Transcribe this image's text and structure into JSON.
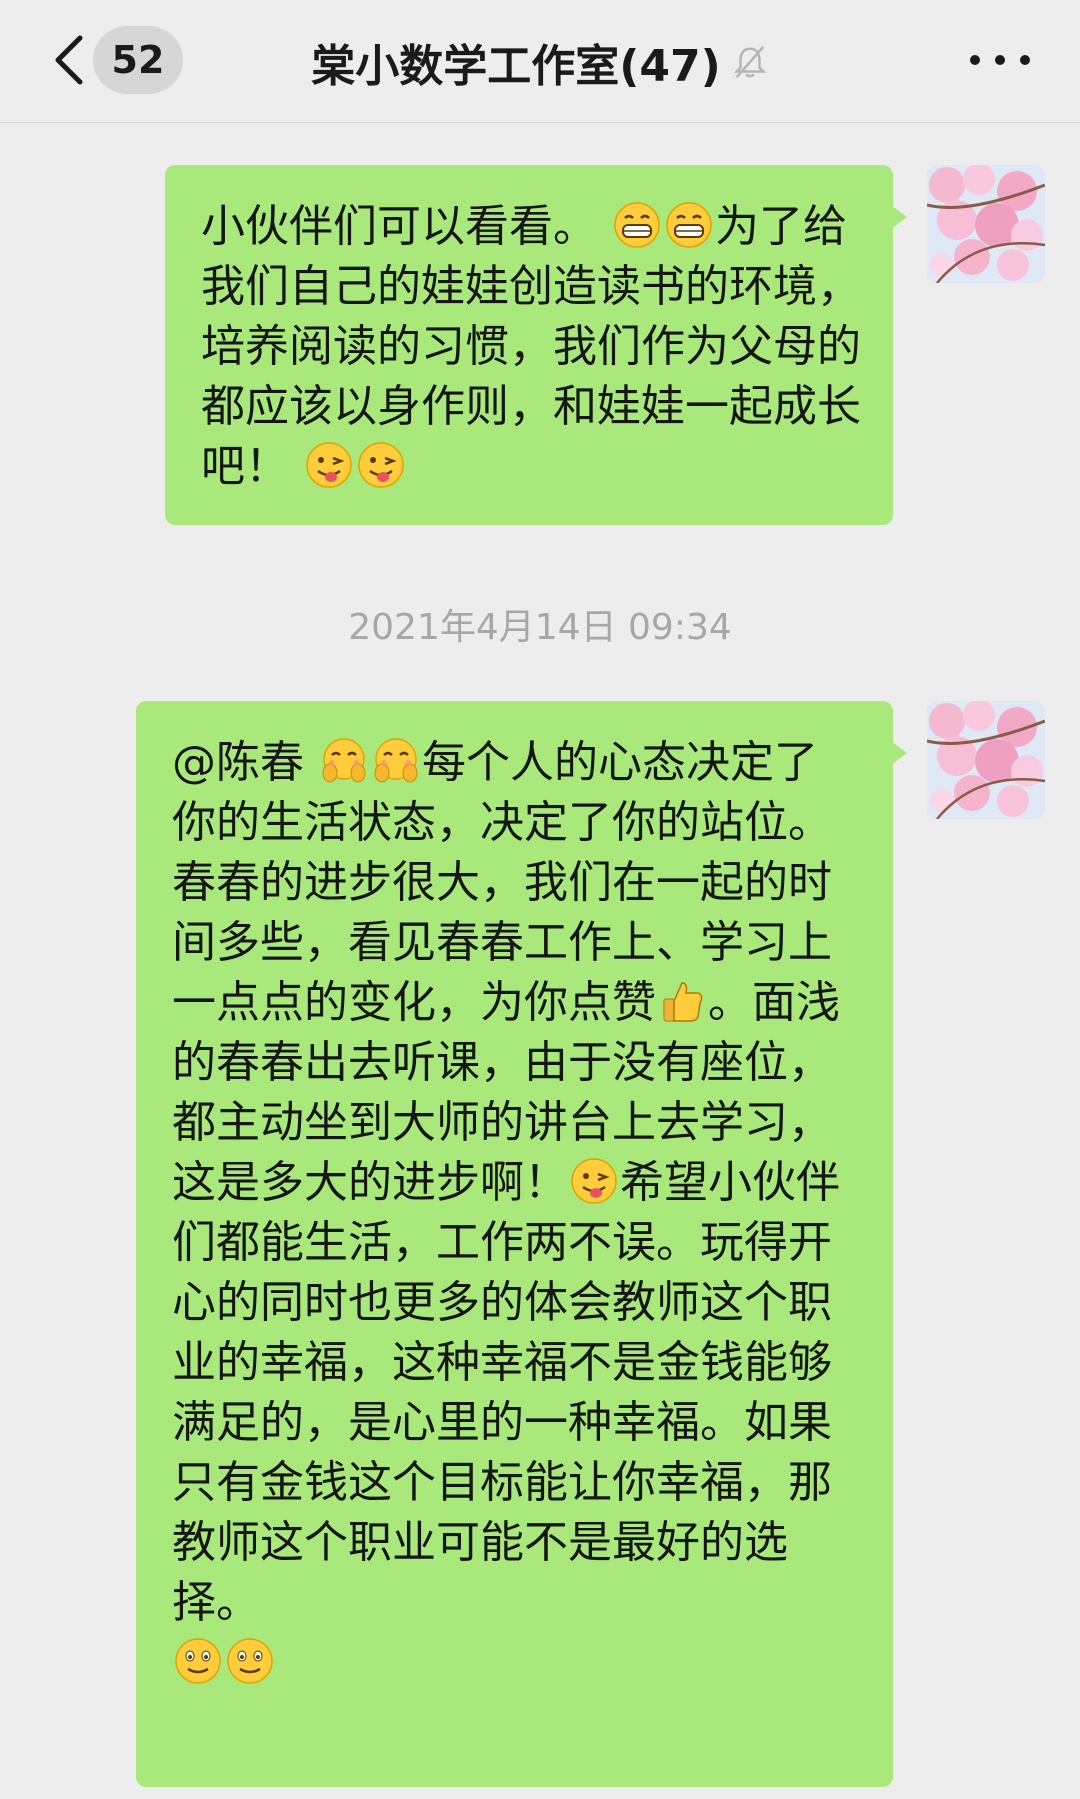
{
  "nav": {
    "unread_count": "52",
    "title": "棠小数学工作室(47)"
  },
  "messages": [
    {
      "text_parts": [
        "小伙伴们可以看看。",
        "为了给我们自己的娃娃创造读书的环境，培养阅读的习惯，我们作为父母的都应该以身作则，和娃娃一起成长吧！",
        ""
      ],
      "emoji": [
        "grin-emoji",
        "grin-emoji",
        "wink-tongue-emoji",
        "wink-tongue-emoji"
      ]
    },
    {
      "text_parts": [
        "@陈春 ",
        "每个人的心态决定了你的生活状态，决定了你的站位。春春的进步很大，我们在一起的时间多些，看见春春工作上、学习上一点点的变化，为你点赞",
        "。面浅的春春出去听课，由于没有座位，都主动坐到大师的讲台上去学习，这是多大的进步啊！",
        "希望小伙伴们都能生活，工作两不误。玩得开心的同时也更多的体会教师这个职业的幸福，这种幸福不是金钱能够满足的，是心里的一种幸福。如果只有金钱这个目标能让你幸福，那教师这个职业可能不是最好的选择。"
      ],
      "emoji": [
        "hehe-emoji",
        "hehe-emoji",
        "thumbs-up-emoji",
        "wink-tongue-emoji",
        "smile-emoji",
        "smile-emoji"
      ]
    }
  ],
  "timestamp": "2021年4月14日 09:34"
}
